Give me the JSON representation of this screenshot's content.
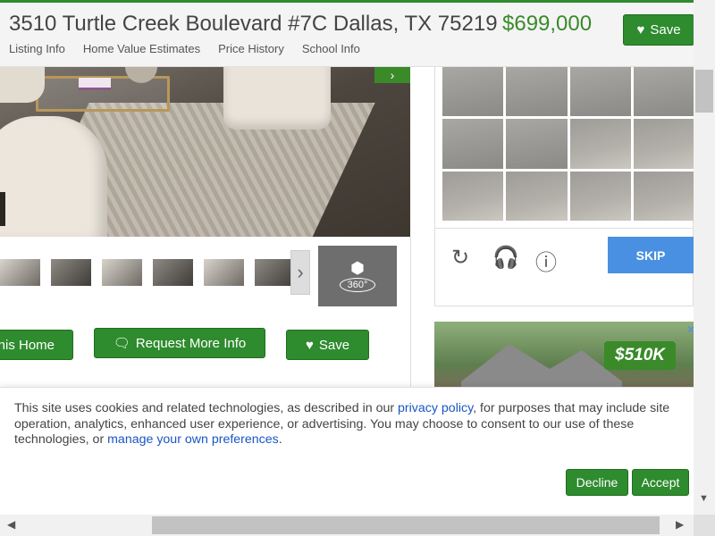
{
  "header": {
    "address": "3510 Turtle Creek Boulevard #7C Dallas, TX 75219",
    "price": "$699,000",
    "save_label": "Save",
    "nav": [
      "Listing Info",
      "Home Value Estimates",
      "Price History",
      "School Info"
    ]
  },
  "gallery": {
    "next_icon": "chevron-right-icon",
    "tour_label": "360°",
    "thumbnail_count": 6
  },
  "actions": {
    "home_label": "his Home",
    "info_label": "Request More Info",
    "save_label": "Save"
  },
  "captcha": {
    "skip_label": "SKIP",
    "tools": [
      "reload-icon",
      "headphones-icon",
      "info-icon"
    ]
  },
  "ad": {
    "price_badge": "$510K"
  },
  "cookie": {
    "text_1": "This site uses cookies and related technologies, as described in our ",
    "link_1": "privacy policy",
    "text_2": ", for purposes that may include site operation, analytics, enhanced user experience, or advertising. You may choose to consent to our use of these technologies, or ",
    "link_2": "manage your own preferences",
    "text_3": ".",
    "decline_label": "Decline",
    "accept_label": "Accept"
  },
  "colors": {
    "brand_green": "#2e8b2e",
    "price_green": "#3a8a2a",
    "link_blue": "#1a56c4",
    "skip_blue": "#4a90e2"
  }
}
